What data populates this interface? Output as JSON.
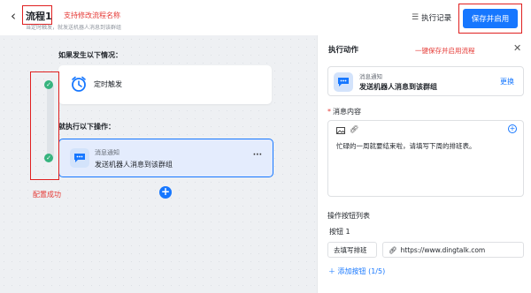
{
  "header": {
    "back_icon": "chevron-left-icon",
    "title": "流程1",
    "title_annotation": "支持修改流程名称",
    "subtitle": "当定时触发，就发送机器人消息到该群组",
    "exec_log_label": "执行记录",
    "exec_log_icon": "list-icon",
    "save_button_label": "保存并启用"
  },
  "canvas": {
    "if_label": "如果发生以下情况：",
    "trigger": {
      "icon": "alarm-clock-icon",
      "label": "定时触发"
    },
    "then_label": "就执行以下操作：",
    "action": {
      "icon": "message-icon",
      "title": "消息通知",
      "desc": "发送机器人消息到该群组",
      "more": "···"
    },
    "config_success": "配置成功",
    "add_step_icon": "plus-icon"
  },
  "panel": {
    "title": "执行动作",
    "annotation": "一键保存并启用流程",
    "close_icon": "close-icon",
    "action_block": {
      "title": "消息通知",
      "desc": "发送机器人消息到该群组",
      "change_label": "更换"
    },
    "message_content_label": "消息内容",
    "required_mark": "*",
    "editor_text": "忙碌的一周就要结束啦，请填写下周的排班表。",
    "button_list_label": "操作按钮列表",
    "button1": {
      "label": "按钮 1",
      "text": "去填写排班",
      "url": "https://www.dingtalk.com"
    },
    "add_button_label": "添加按钮 (1/5)"
  },
  "colors": {
    "accent": "#1677ff",
    "annotation": "#e53935",
    "success": "#36b37e"
  }
}
